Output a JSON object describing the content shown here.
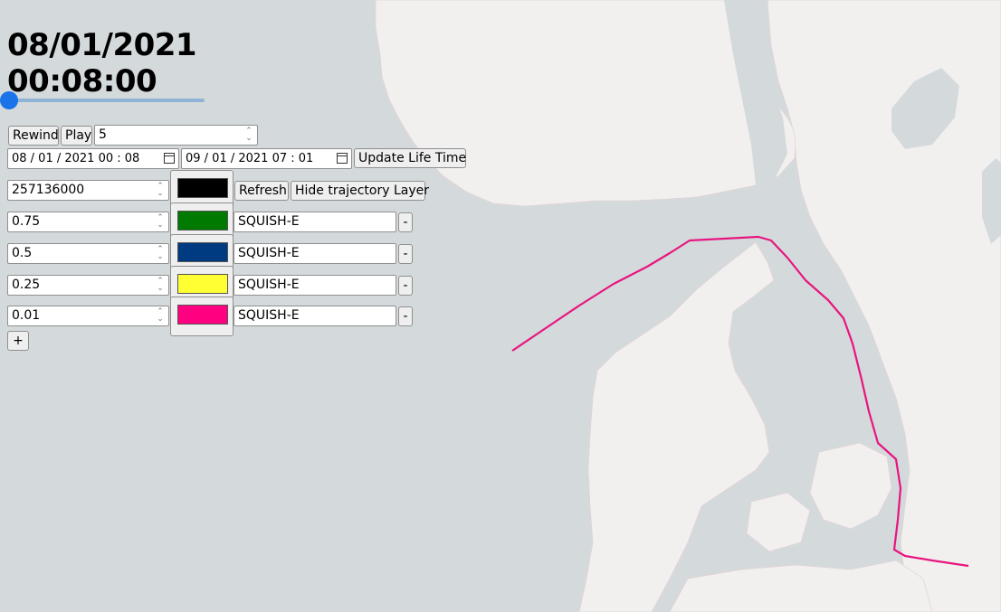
{
  "timestamp": "08/01/2021 00:08:00",
  "controls": {
    "rewind_label": "Rewind",
    "play_label": "Play",
    "speed_value": "5",
    "start_date": "08 / 01 / 2021   00 : 08",
    "end_date": "09 / 01 / 2021   07 : 01",
    "update_label": "Update Life Time",
    "slider_position": 0
  },
  "layers": {
    "id_value": "257136000",
    "base_color": "#000000",
    "refresh_label": "Refresh",
    "hide_label": "Hide trajectory Layer",
    "rows": [
      {
        "value": "0.75",
        "color": "#007a00",
        "algorithm": "SQUISH-E",
        "remove_label": "-"
      },
      {
        "value": "0.5",
        "color": "#003a80",
        "algorithm": "SQUISH-E",
        "remove_label": "-"
      },
      {
        "value": "0.25",
        "color": "#ffff33",
        "algorithm": "SQUISH-E",
        "remove_label": "-"
      },
      {
        "value": "0.01",
        "color": "#ff0080",
        "algorithm": "SQUISH-E",
        "remove_label": "-"
      }
    ],
    "add_label": "+"
  },
  "map": {
    "sea_color": "#d4dadc",
    "land_color": "#f2f0ee",
    "trajectory_color": "#e8157f"
  }
}
